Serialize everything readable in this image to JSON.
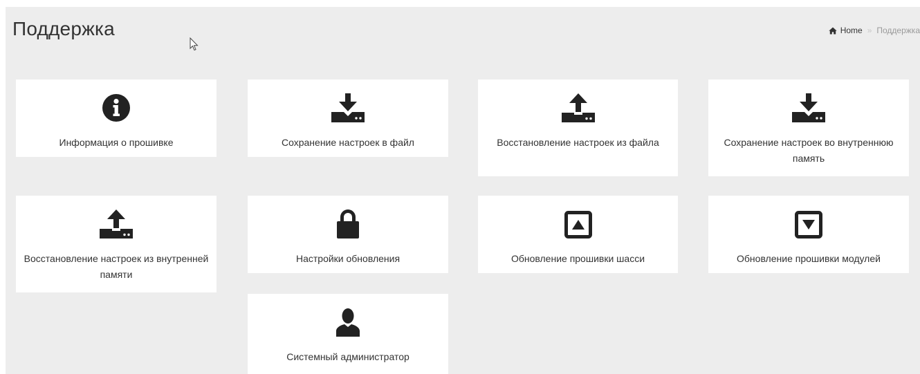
{
  "header": {
    "title": "Поддержка"
  },
  "breadcrumb": {
    "home_label": "Home",
    "separator": "»",
    "current": "Поддержка"
  },
  "tiles": [
    {
      "icon": "info-circle-icon",
      "label": "Информация о прошивке"
    },
    {
      "icon": "download-icon",
      "label": "Сохранение настроек в файл"
    },
    {
      "icon": "upload-icon",
      "label": "Восстановление настроек из файла"
    },
    {
      "icon": "download-icon",
      "label": "Сохранение настроек во внутреннюю память"
    },
    {
      "icon": "upload-icon",
      "label": "Восстановление настроек из внутренней памяти"
    },
    {
      "icon": "lock-icon",
      "label": "Настройки обновления"
    },
    {
      "icon": "caret-square-up-icon",
      "label": "Обновление прошивки шасси"
    },
    {
      "icon": "caret-square-down-icon",
      "label": "Обновление прошивки модулей"
    },
    {
      "icon": "user-icon",
      "label": "Системный администратор"
    }
  ]
}
